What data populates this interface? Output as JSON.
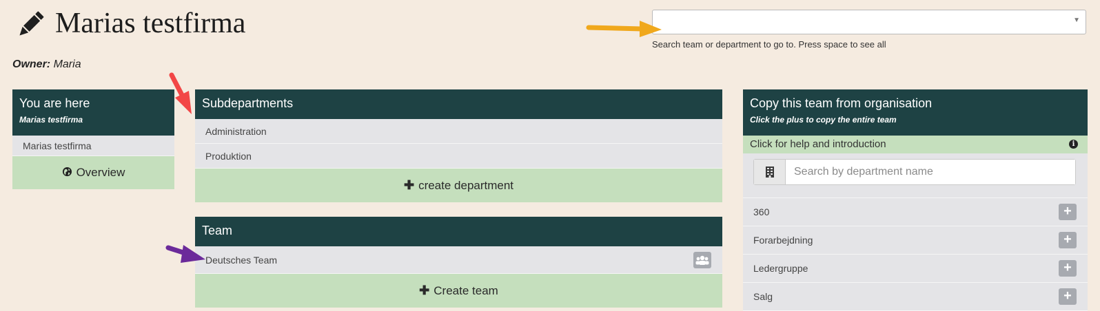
{
  "header": {
    "title": "Marias testfirma",
    "icon": "pencil-icon",
    "owner_label": "Owner:",
    "owner_value": "Maria"
  },
  "search": {
    "value": "",
    "help_text": "Search team or department to go to. Press space to see all"
  },
  "location_panel": {
    "title": "You are here",
    "subtitle": "Marias testfirma",
    "items": [
      {
        "label": "Marias testfirma"
      }
    ],
    "overview_icon": "globe-icon",
    "overview_label": "Overview"
  },
  "subdepartments_panel": {
    "title": "Subdepartments",
    "items": [
      {
        "label": "Administration"
      },
      {
        "label": "Produktion"
      }
    ],
    "create_label": "create department"
  },
  "team_panel": {
    "title": "Team",
    "items": [
      {
        "label": "Deutsches Team",
        "icon": "users-icon"
      }
    ],
    "create_label": "Create team"
  },
  "copy_panel": {
    "title": "Copy this team from organisation",
    "subtitle": "Click the plus to copy the entire team",
    "help_label": "Click for help and introduction",
    "search_placeholder": "Search by department name",
    "items": [
      {
        "label": "360"
      },
      {
        "label": "Forarbejdning"
      },
      {
        "label": "Ledergruppe"
      },
      {
        "label": "Salg"
      }
    ]
  },
  "colors": {
    "background": "#f5ebe0",
    "panel_header": "#1e4244",
    "action_green": "#c5dfbd",
    "row_gray": "#e4e4e7",
    "arrow_orange": "#f0a81c",
    "arrow_red": "#f24646",
    "arrow_purple": "#6b2a9a"
  }
}
